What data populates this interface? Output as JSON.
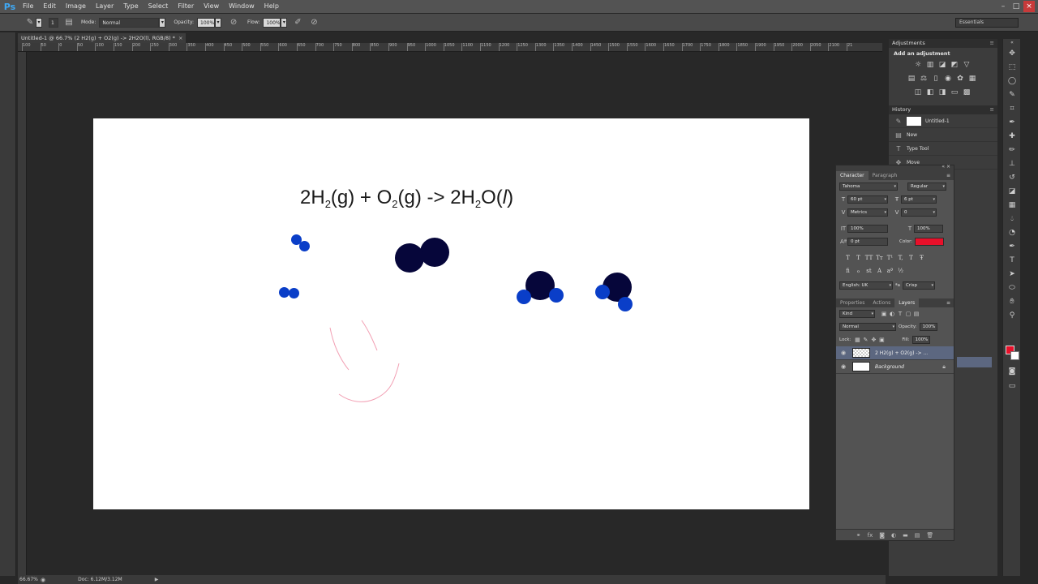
{
  "app": {
    "logo": "Ps"
  },
  "menu": [
    "File",
    "Edit",
    "Image",
    "Layer",
    "Type",
    "Select",
    "Filter",
    "View",
    "Window",
    "Help"
  ],
  "window_buttons": {
    "minimize": "–",
    "maximize": "□",
    "close": "×"
  },
  "options": {
    "brush_size": "1",
    "mode_label": "Mode:",
    "mode_value": "Normal",
    "opacity_label": "Opacity:",
    "opacity_value": "100%",
    "flow_label": "Flow:",
    "flow_value": "100%",
    "workspace": "Essentials"
  },
  "document": {
    "tab_title": "Untitled-1 @ 66.7% (2 H2(g)  + O2(g)  -> 2H2O(l), RGB/8) *",
    "tab_close": "×"
  },
  "ruler_ticks": [
    "100",
    "50",
    "0",
    "50",
    "100",
    "150",
    "200",
    "250",
    "300",
    "350",
    "400",
    "450",
    "500",
    "550",
    "600",
    "650",
    "700",
    "750",
    "800",
    "850",
    "900",
    "950",
    "1000",
    "1050",
    "1100",
    "1150",
    "1200",
    "1250",
    "1300",
    "1350",
    "1400",
    "1450",
    "1500",
    "1550",
    "1600",
    "1650",
    "1700",
    "1750",
    "1800",
    "1850",
    "1900",
    "1950",
    "2000",
    "2050",
    "2100",
    "21"
  ],
  "canvas": {
    "equation": {
      "c1": "2H",
      "s1": "2",
      "p1": "(g)  +  O",
      "s2": "2",
      "p2": "(g)   -> 2H",
      "s3": "2",
      "p3": "O(",
      "italic": "l",
      "p4": ")"
    },
    "colors": {
      "hydrogen": "#0a3ec8",
      "oxygen": "#06063a",
      "sketch": "#f2a0b4"
    }
  },
  "status": {
    "zoom": "66.67%",
    "doc": "Doc: 6.12M/3.12M",
    "arrow": "▶"
  },
  "panels": {
    "adjustments": {
      "tab": "Adjustments",
      "title": "Add an adjustment"
    },
    "history": {
      "tab": "History",
      "items": [
        {
          "label": "Untitled-1"
        },
        {
          "label": "New"
        },
        {
          "label": "Type Tool"
        },
        {
          "label": "Move"
        }
      ]
    },
    "character": {
      "tabs": [
        "Character",
        "Paragraph"
      ],
      "font_family": "Tahoma",
      "font_style": "Regular",
      "size": "60 pt",
      "leading": "6 pt",
      "kerning": "Metrics",
      "tracking": "0",
      "vscale": "100%",
      "hscale": "100%",
      "baseline": "0 pt",
      "color_label": "Color:",
      "color": "#e8102a",
      "styles": [
        "T",
        "T",
        "TT",
        "Tт",
        "T¹",
        "T,",
        "T",
        "Ŧ"
      ],
      "language": "English: UK",
      "aa_label": "ªa",
      "antialias": "Crisp"
    },
    "layers": {
      "tabs": [
        "Properties",
        "Actions",
        "Layers"
      ],
      "kind": "Kind",
      "blend": "Normal",
      "opacity_label": "Opacity:",
      "opacity": "100%",
      "lock_label": "Lock:",
      "fill_label": "Fill:",
      "fill": "100%",
      "items": [
        {
          "name": "2 H2(g)  + O2(g)  -> ..."
        },
        {
          "name": "Background"
        }
      ]
    }
  }
}
